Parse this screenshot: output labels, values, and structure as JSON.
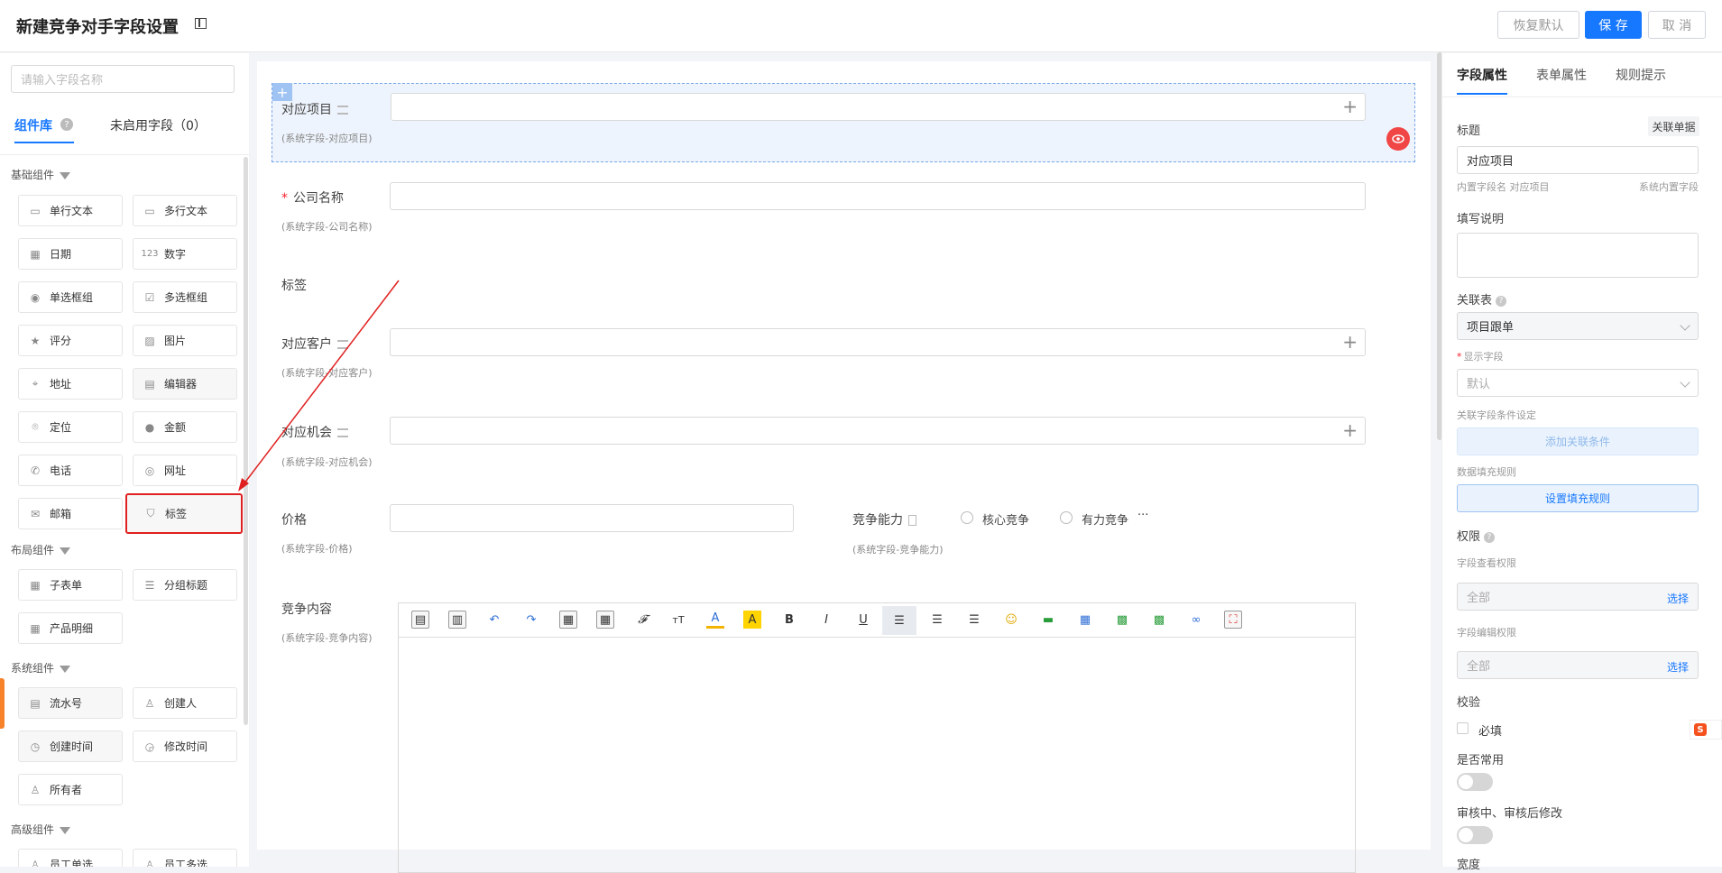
{
  "header": {
    "title": "新建竞争对手字段设置",
    "restore_label": "恢复默认",
    "save_label": "保 存",
    "cancel_label": "取 消"
  },
  "left": {
    "search_placeholder": "请输入字段名称",
    "tabs": [
      "组件库",
      "未启用字段（0）"
    ],
    "groups": {
      "basic": "基础组件",
      "layout": "布局组件",
      "system": "系统组件",
      "advanced": "高级组件"
    },
    "basic_items": [
      "单行文本",
      "多行文本",
      "日期",
      "数字",
      "单选框组",
      "多选框组",
      "评分",
      "图片",
      "地址",
      "编辑器",
      "定位",
      "金额",
      "电话",
      "网址",
      "邮箱",
      "标签"
    ],
    "layout_items": [
      "子表单",
      "分组标题",
      "产品明细"
    ],
    "system_items": [
      "流水号",
      "创建人",
      "创建时间",
      "修改时间",
      "所有者"
    ],
    "advanced_items": [
      "员工单选",
      "员工多选"
    ]
  },
  "form": {
    "field1": {
      "label": "对应项目",
      "sub": "(系统字段-对应项目)"
    },
    "field2": {
      "label": "公司名称",
      "sub": "(系统字段-公司名称)"
    },
    "field3": {
      "label": "标签"
    },
    "field4": {
      "label": "对应客户",
      "sub": "(系统字段-对应客户)"
    },
    "field5": {
      "label": "对应机会",
      "sub": "(系统字段-对应机会)"
    },
    "field6": {
      "label": "价格",
      "sub": "(系统字段-价格)"
    },
    "field7": {
      "label": "竞争能力",
      "sub": "(系统字段-竞争能力)",
      "options": [
        "核心竞争",
        "有力竞争"
      ],
      "more": "···"
    },
    "field8": {
      "label": "竞争内容",
      "sub": "(系统字段-竞争内容)"
    },
    "required_mark": "*"
  },
  "right": {
    "tabs": [
      "字段属性",
      "表单属性",
      "规则提示"
    ],
    "title_label": "标题",
    "relate_button": "关联单据",
    "title_value": "对应项目",
    "internal_name": "内置字段名 对应项目",
    "system_builtin": "系统内置字段",
    "desc_label": "填写说明",
    "relate_table_label": "关联表",
    "relate_table_value": "项目跟单",
    "display_field_label": "显示字段",
    "display_field_value": "默认",
    "cond_label": "关联字段条件设定",
    "cond_button": "添加关联条件",
    "fill_label": "数据填充规则",
    "fill_button": "设置填充规则",
    "perm_label": "权限",
    "view_perm_label": "字段查看权限",
    "view_perm_value": "全部",
    "edit_perm_label": "字段编辑权限",
    "edit_perm_value": "全部",
    "choose": "选择",
    "validate_label": "校验",
    "required_label": "必填",
    "common_label": "是否常用",
    "audit_label": "审核中、审核后修改",
    "width_label": "宽度"
  },
  "colors": {
    "primary": "#1677ff",
    "danger": "#f04646",
    "highlight": "#e02020"
  }
}
